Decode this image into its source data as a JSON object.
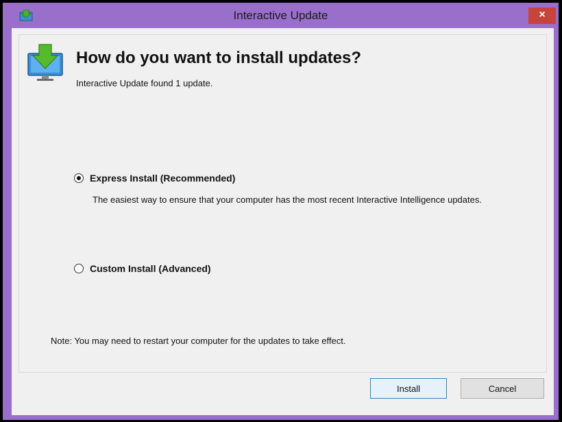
{
  "window": {
    "title": "Interactive Update",
    "close_label": "×"
  },
  "header": {
    "heading": "How do you want to install updates?",
    "subtext": "Interactive Update found 1 update."
  },
  "options": [
    {
      "label": "Express Install (Recommended)",
      "selected": true,
      "description": "The easiest way to ensure that your computer has the most recent Interactive Intelligence updates."
    },
    {
      "label": "Custom Install (Advanced)",
      "selected": false
    }
  ],
  "note": "Note: You may need to restart your computer for the updates to take effect.",
  "buttons": {
    "install": "Install",
    "cancel": "Cancel"
  },
  "colors": {
    "frame": "#9a6fcb",
    "close": "#c7443a",
    "arrow": "#4caf2e",
    "monitor": "#3a8fd6"
  },
  "icons": {
    "title": "download-arrow-icon",
    "hero": "monitor-download-icon"
  }
}
